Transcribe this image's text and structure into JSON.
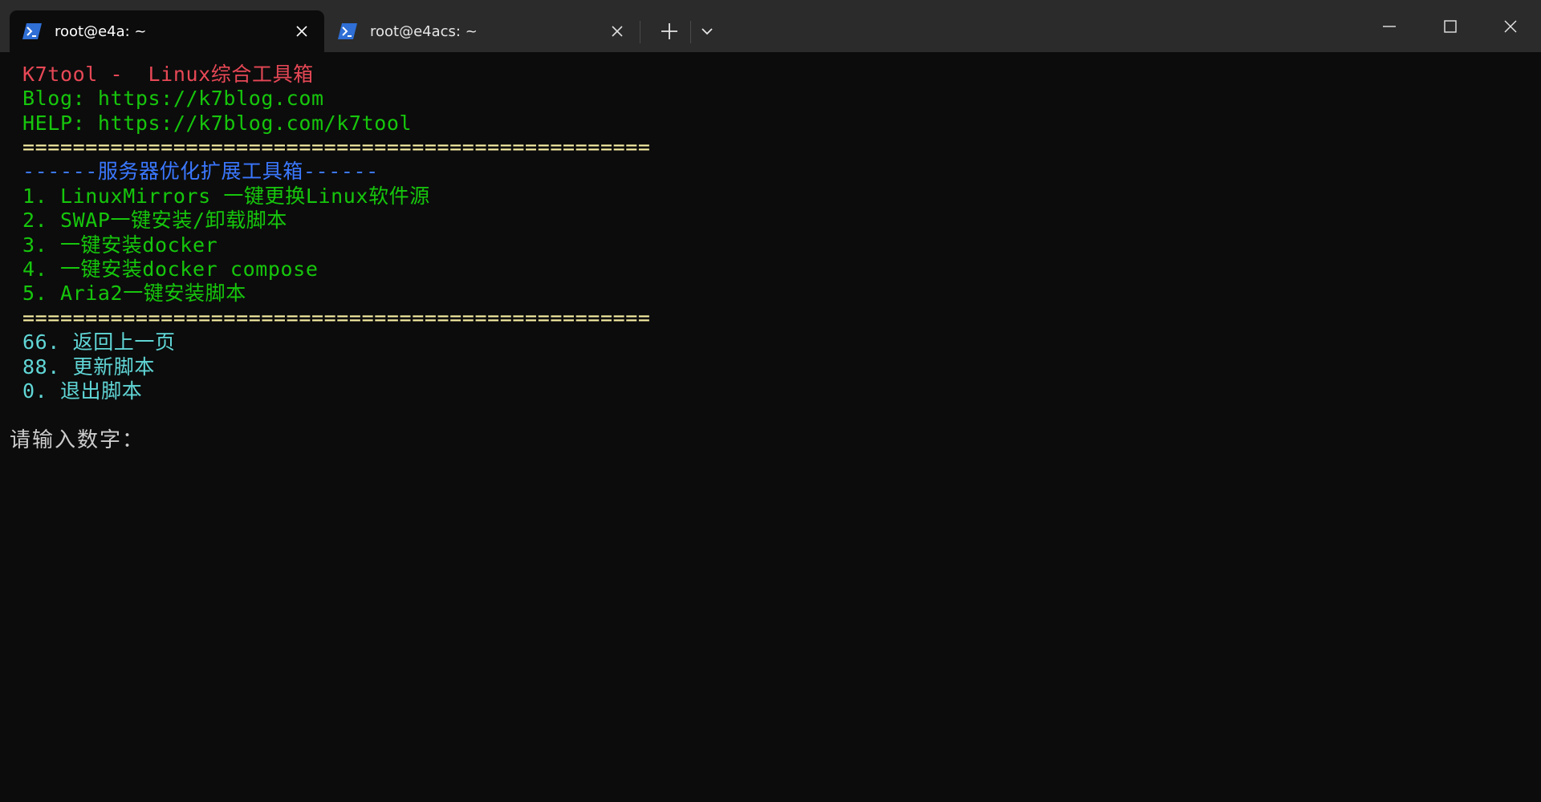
{
  "tabs": [
    {
      "title": "root@e4a: ~",
      "active": true,
      "icon": "powershell-icon"
    },
    {
      "title": "root@e4acs: ~",
      "active": false,
      "icon": "powershell-icon"
    }
  ],
  "window_controls": {
    "new_tab_icon": "plus-icon",
    "dropdown_icon": "chevron-down-icon",
    "minimize_icon": "minimize-icon",
    "maximize_icon": "maximize-icon",
    "close_icon": "close-icon"
  },
  "terminal": {
    "header_title": "K7tool -  Linux综合工具箱",
    "blog_line": "Blog: https://k7blog.com",
    "help_line": "HELP: https://k7blog.com/k7tool",
    "separator": "==================================================",
    "section_title": "------服务器优化扩展工具箱------",
    "menu_items": [
      "1. LinuxMirrors 一键更换Linux软件源",
      "2. SWAP一键安装/卸载脚本",
      "3. 一键安装docker",
      "4. 一键安装docker compose",
      "5. Aria2一键安装脚本"
    ],
    "separator_bottom": "==================================================",
    "control_items": [
      "66. 返回上一页",
      "88. 更新脚本",
      "0. 退出脚本"
    ],
    "prompt": "请输入数字："
  },
  "colors": {
    "background": "#0c0c0c",
    "titlebar": "#2b2b2b",
    "red": "#e74856",
    "green": "#16c60c",
    "yellow": "#f9f1a5",
    "blue": "#3b78ff",
    "cyan": "#61d6d6",
    "prompt": "#cccccc"
  }
}
